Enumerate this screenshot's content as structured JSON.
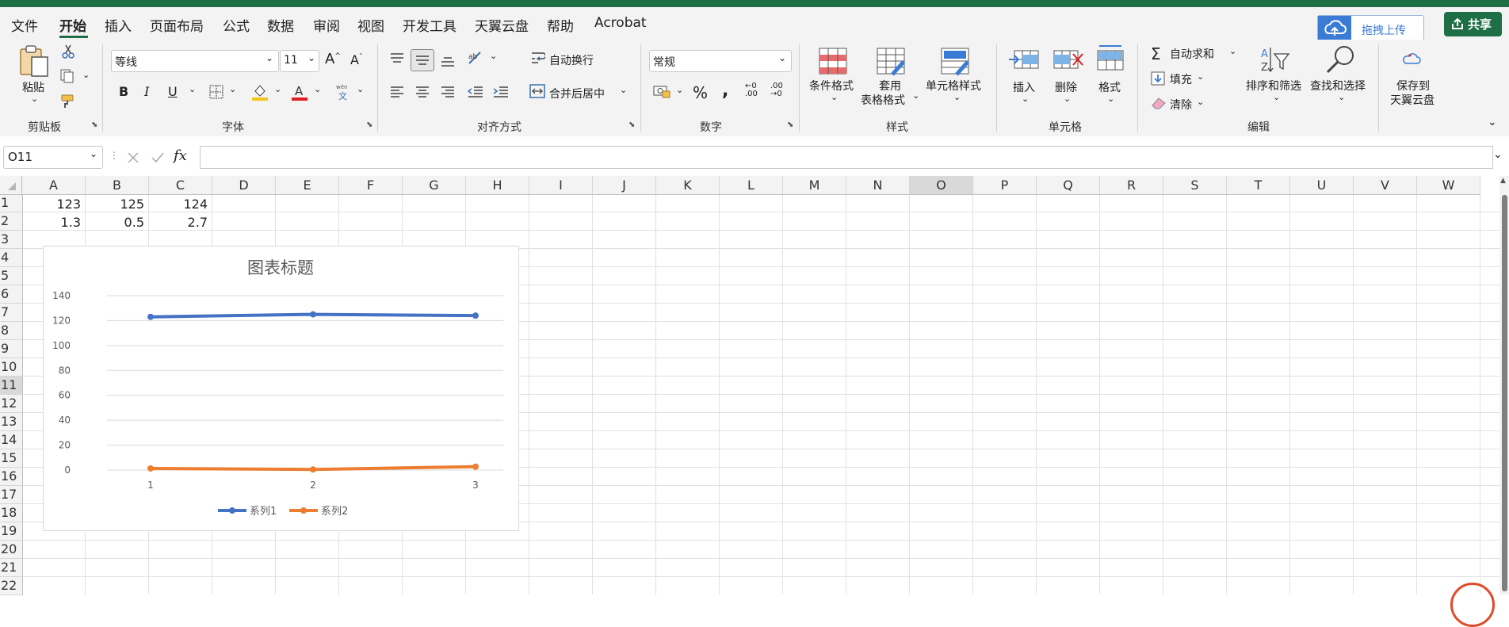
{
  "menu": {
    "items": [
      "文件",
      "开始",
      "插入",
      "页面布局",
      "公式",
      "数据",
      "审阅",
      "视图",
      "开发工具",
      "天翼云盘",
      "帮助",
      "Acrobat"
    ],
    "active": "开始"
  },
  "upload": {
    "label": "拖拽上传"
  },
  "share": {
    "label": "共享"
  },
  "clipboard": {
    "paste_label": "粘贴",
    "group_label": "剪贴板"
  },
  "font": {
    "name": "等线",
    "size": "11",
    "group_label": "字体"
  },
  "alignment": {
    "wrap_label": "自动换行",
    "merge_label": "合并后居中",
    "group_label": "对齐方式"
  },
  "number": {
    "format": "常规",
    "group_label": "数字"
  },
  "styles": {
    "conditional_label": "条件格式",
    "table_label_1": "套用",
    "table_label_2": "表格格式",
    "cell_styles_label": "单元格样式",
    "group_label": "样式"
  },
  "cells": {
    "insert_label": "插入",
    "delete_label": "删除",
    "format_label": "格式",
    "group_label": "单元格"
  },
  "editing": {
    "autosum_label": "自动求和",
    "fill_label": "填充",
    "clear_label": "清除",
    "sort_label": "排序和筛选",
    "find_label": "查找和选择",
    "group_label": "编辑"
  },
  "cloud": {
    "label_1": "保存到",
    "label_2": "天翼云盘"
  },
  "formula_bar": {
    "name_box": "O11",
    "fx": "fx",
    "content": ""
  },
  "sheet": {
    "columns": [
      "A",
      "B",
      "C",
      "D",
      "E",
      "F",
      "G",
      "H",
      "I",
      "J",
      "K",
      "L",
      "M",
      "N",
      "O",
      "P",
      "Q",
      "R",
      "S",
      "T",
      "U",
      "V",
      "W"
    ],
    "rows": [
      "1",
      "2",
      "3",
      "4",
      "5",
      "6",
      "7",
      "8",
      "9",
      "10",
      "11",
      "12",
      "13",
      "14",
      "15",
      "16",
      "17",
      "18",
      "19",
      "20",
      "21",
      "22"
    ],
    "selected_column": "O",
    "selected_row": "11",
    "cells": {
      "A1": "123",
      "B1": "125",
      "C1": "124",
      "A2": "1.3",
      "B2": "0.5",
      "C2": "2.7"
    }
  },
  "chart_data": {
    "type": "line",
    "title": "图表标题",
    "categories": [
      "1",
      "2",
      "3"
    ],
    "series": [
      {
        "name": "系列1",
        "values": [
          123,
          125,
          124
        ],
        "color": "#4472c4"
      },
      {
        "name": "系列2",
        "values": [
          1.3,
          0.5,
          2.7
        ],
        "color": "#ed7d31"
      }
    ],
    "ylim": [
      0,
      140
    ],
    "yticks": [
      "0",
      "20",
      "40",
      "60",
      "80",
      "100",
      "120",
      "140"
    ],
    "grid": true,
    "legend": "bottom",
    "xlabel": "",
    "ylabel": ""
  }
}
